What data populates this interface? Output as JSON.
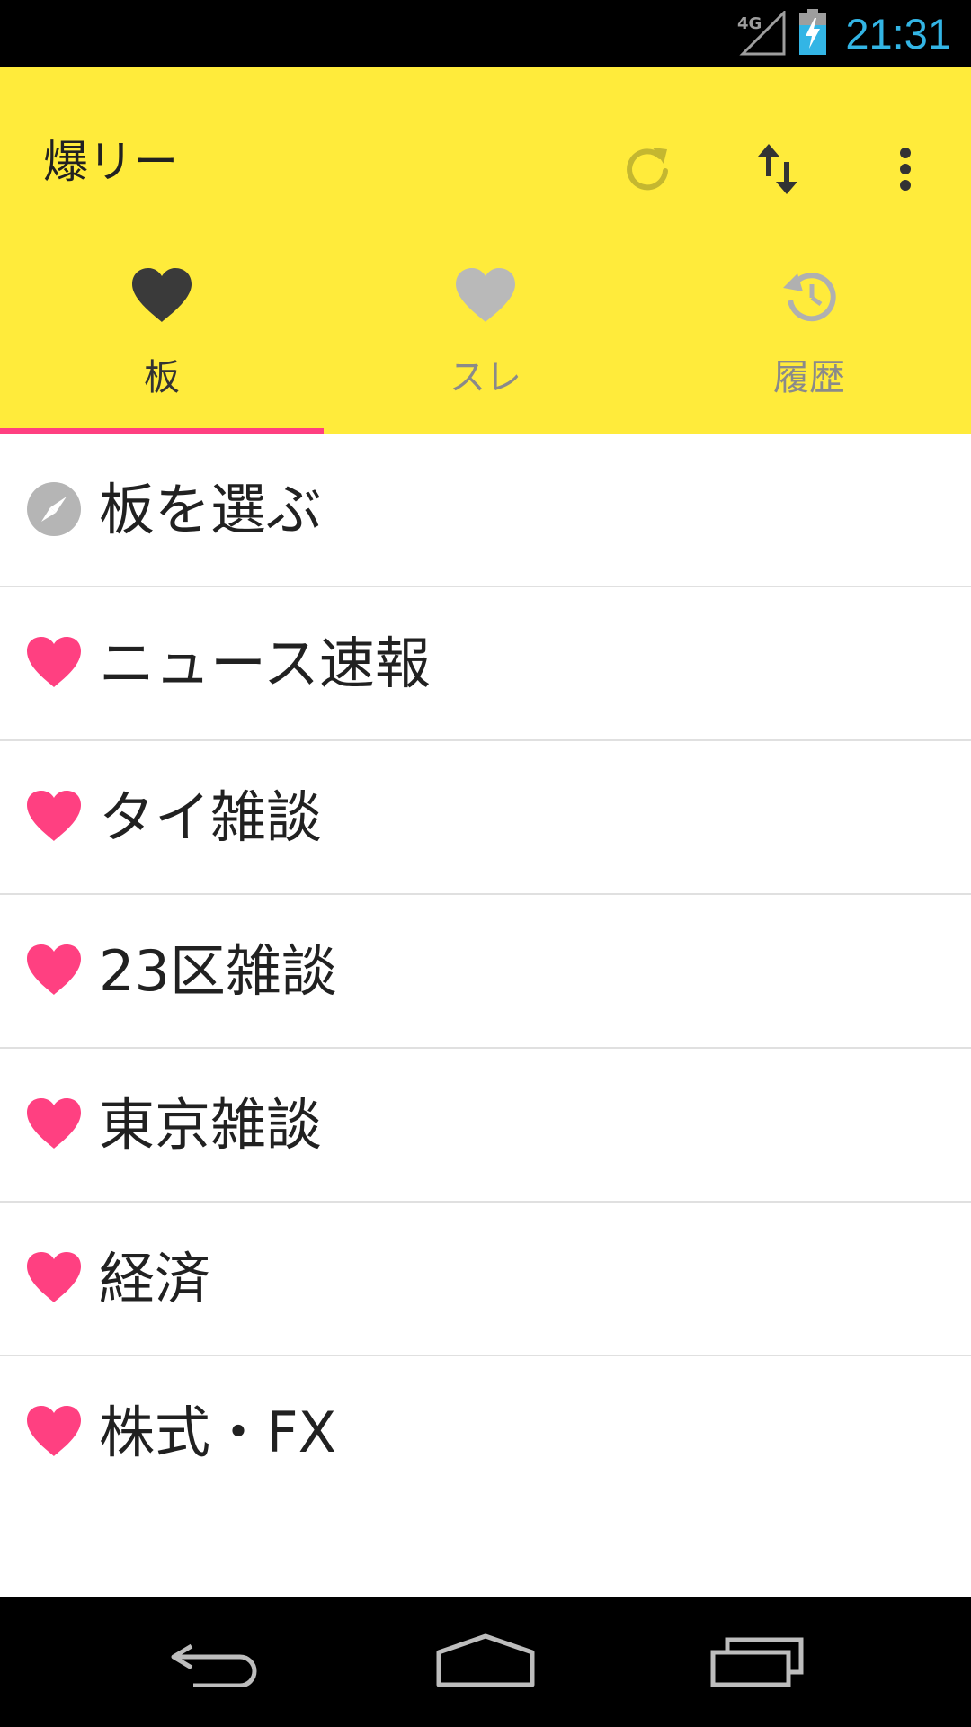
{
  "status_bar": {
    "network": "4G",
    "time": "21:31"
  },
  "app_bar": {
    "title": "爆リー",
    "actions": [
      {
        "icon": "refresh-icon"
      },
      {
        "icon": "sort-icon"
      },
      {
        "icon": "more-vert-icon"
      }
    ]
  },
  "tabs": [
    {
      "label": "板",
      "icon": "heart-icon",
      "selected": true
    },
    {
      "label": "スレ",
      "icon": "heart-icon",
      "selected": false
    },
    {
      "label": "履歴",
      "icon": "history-icon",
      "selected": false
    }
  ],
  "boards": {
    "items": [
      {
        "label": "板を選ぶ",
        "icon": "compass-icon"
      },
      {
        "label": "ニュース速報",
        "icon": "heart-icon"
      },
      {
        "label": "タイ雑談",
        "icon": "heart-icon"
      },
      {
        "label": "23区雑談",
        "icon": "heart-icon"
      },
      {
        "label": "東京雑談",
        "icon": "heart-icon"
      },
      {
        "label": "経済",
        "icon": "heart-icon"
      },
      {
        "label": "株式・FX",
        "icon": "heart-icon"
      }
    ]
  },
  "colors": {
    "toolbar": "#ffeb3b",
    "accent": "#ff4081",
    "clock": "#33b5e5"
  },
  "nav_bar": {
    "buttons": [
      "back-icon",
      "home-icon",
      "recents-icon"
    ]
  }
}
